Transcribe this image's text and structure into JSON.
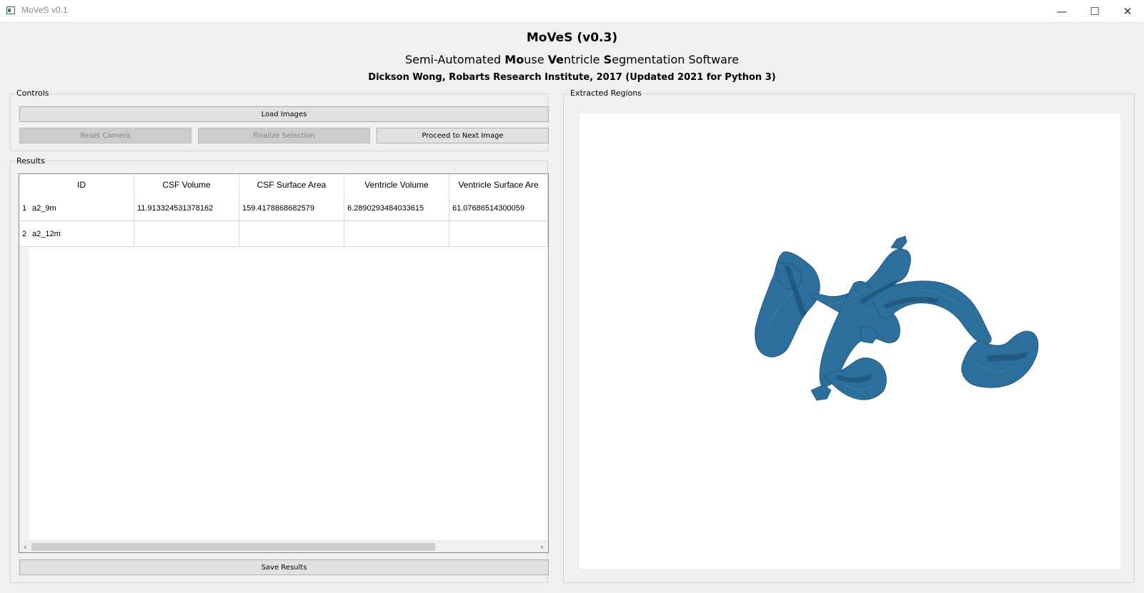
{
  "window": {
    "title": "MoVeS v0.1",
    "minimize_glyph": "—",
    "maximize_glyph": "☐",
    "close_glyph": "✕"
  },
  "header": {
    "title": "MoVeS (v0.3)",
    "subtitle_parts": [
      "Semi-Automated ",
      "Mo",
      "use ",
      "Ve",
      "ntricle ",
      "S",
      "egmentation Software"
    ],
    "credit": "Dickson Wong, Robarts Research Institute, 2017 (Updated 2021 for Python 3)"
  },
  "controls": {
    "group_title": "Controls",
    "load_label": "Load Images",
    "reset_label": "Reset Camera",
    "finalize_label": "Finalize Selection",
    "proceed_label": "Proceed to Next Image"
  },
  "results": {
    "group_title": "Results",
    "columns": [
      "ID",
      "CSF Volume",
      "CSF Surface Area",
      "Ventricle Volume",
      "Ventricle Surface Are"
    ],
    "row_numbers": [
      "1",
      "2"
    ],
    "rows": [
      [
        "a2_9m",
        "11.913324531378162",
        "159.4178868682579",
        "6.2890293484033615",
        "61.07686514300059"
      ],
      [
        "a2_12m",
        "",
        "",
        "",
        ""
      ]
    ],
    "scroll_left_glyph": "‹",
    "scroll_right_glyph": "›",
    "save_label": "Save Results"
  },
  "regions": {
    "group_title": "Extracted Regions",
    "mesh_color": "#2d6f9c"
  }
}
